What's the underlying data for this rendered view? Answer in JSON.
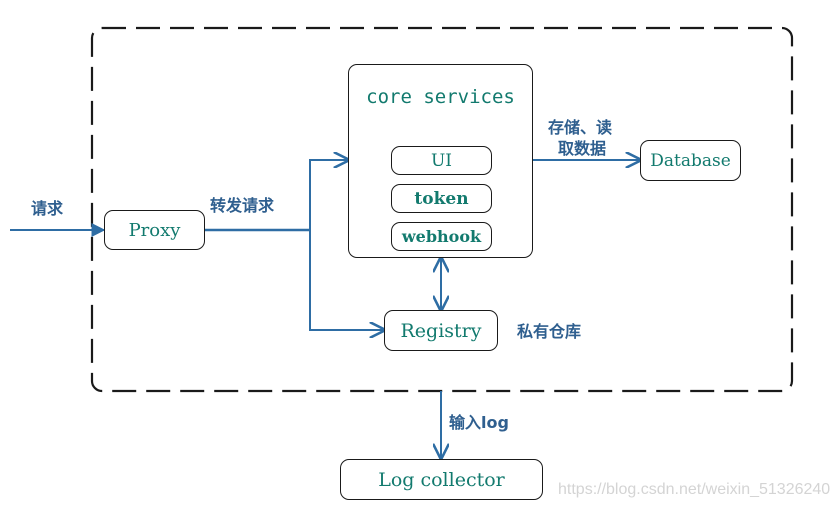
{
  "diagram": {
    "boundary": {
      "style": "dashed"
    },
    "nodes": {
      "proxy": "Proxy",
      "core_services": "core services",
      "ui": "UI",
      "token": "token",
      "webhook": "webhook",
      "database": "Database",
      "registry": "Registry",
      "log_collector": "Log collector"
    },
    "edge_labels": {
      "request": "请求",
      "forward_request": "转发请求",
      "store_read_line1": "存储、读",
      "store_read_line2": "取数据",
      "private_repo": "私有仓库",
      "input_log": "输入log"
    },
    "colors": {
      "arrow": "#2e6da4",
      "node_text": "#127a6e",
      "label_text": "#2f5f8f"
    }
  },
  "watermark": "https://blog.csdn.net/weixin_51326240"
}
